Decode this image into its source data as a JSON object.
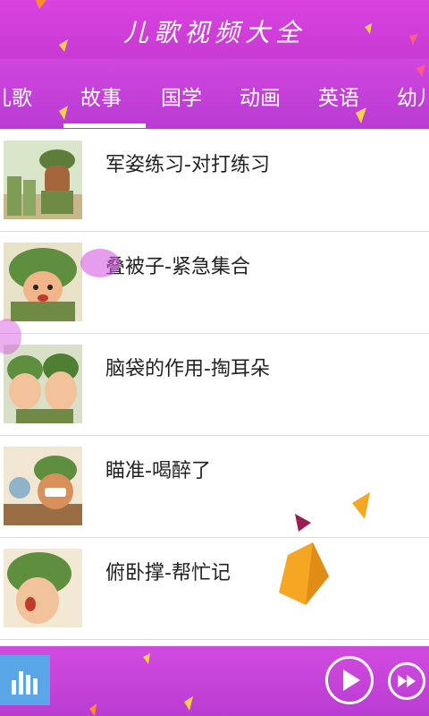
{
  "app": {
    "title": "儿歌视频大全"
  },
  "tabs": [
    {
      "label": "儿歌"
    },
    {
      "label": "故事"
    },
    {
      "label": "国学"
    },
    {
      "label": "动画"
    },
    {
      "label": "英语"
    },
    {
      "label": "幼儿"
    }
  ],
  "active_tab_index": 1,
  "videos": [
    {
      "title": "军姿练习-对打练习"
    },
    {
      "title": "叠被子-紧急集合"
    },
    {
      "title": "脑袋的作用-掏耳朵"
    },
    {
      "title": "瞄准-喝醉了"
    },
    {
      "title": "俯卧撑-帮忙记"
    }
  ],
  "player": {
    "equalizer_icon": "equalizer-icon",
    "play_icon": "play-icon",
    "next_icon": "fast-forward-icon"
  },
  "colors": {
    "header": "#d943e0",
    "tab_bar": "#c63fd9",
    "equalizer_button": "#58a6e8"
  }
}
